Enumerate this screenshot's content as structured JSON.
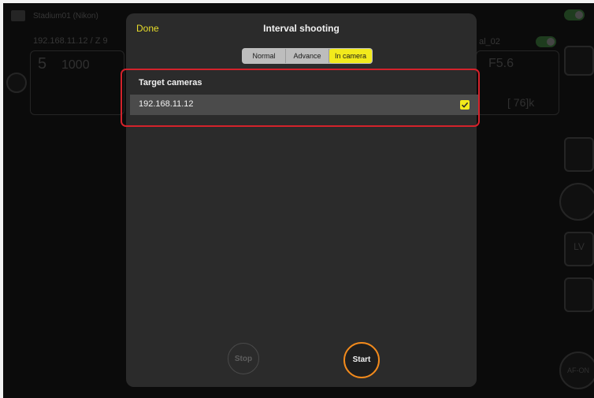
{
  "background": {
    "camera_name": "Stadium01 (Nikon)",
    "camera_address": "192.168.11.12 / Z 9",
    "left_readout_a": "5",
    "left_readout_b": "1000",
    "right_label": "al_02",
    "aperture": "F5.6",
    "shots_remaining": "[ 76]k",
    "lv_label": "LV",
    "af_on_label": "AF-ON"
  },
  "modal": {
    "done_label": "Done",
    "title": "Interval shooting",
    "tabs": [
      "Normal",
      "Advance",
      "In camera"
    ],
    "active_tab": "In camera",
    "section_label": "Target cameras",
    "cameras": [
      {
        "ip": "192.168.11.12",
        "checked": true
      }
    ],
    "stop_label": "Stop",
    "start_label": "Start"
  },
  "colors": {
    "accent_yellow": "#f2ea1c",
    "start_ring": "#f28a1c",
    "highlight": "#d3222b"
  }
}
